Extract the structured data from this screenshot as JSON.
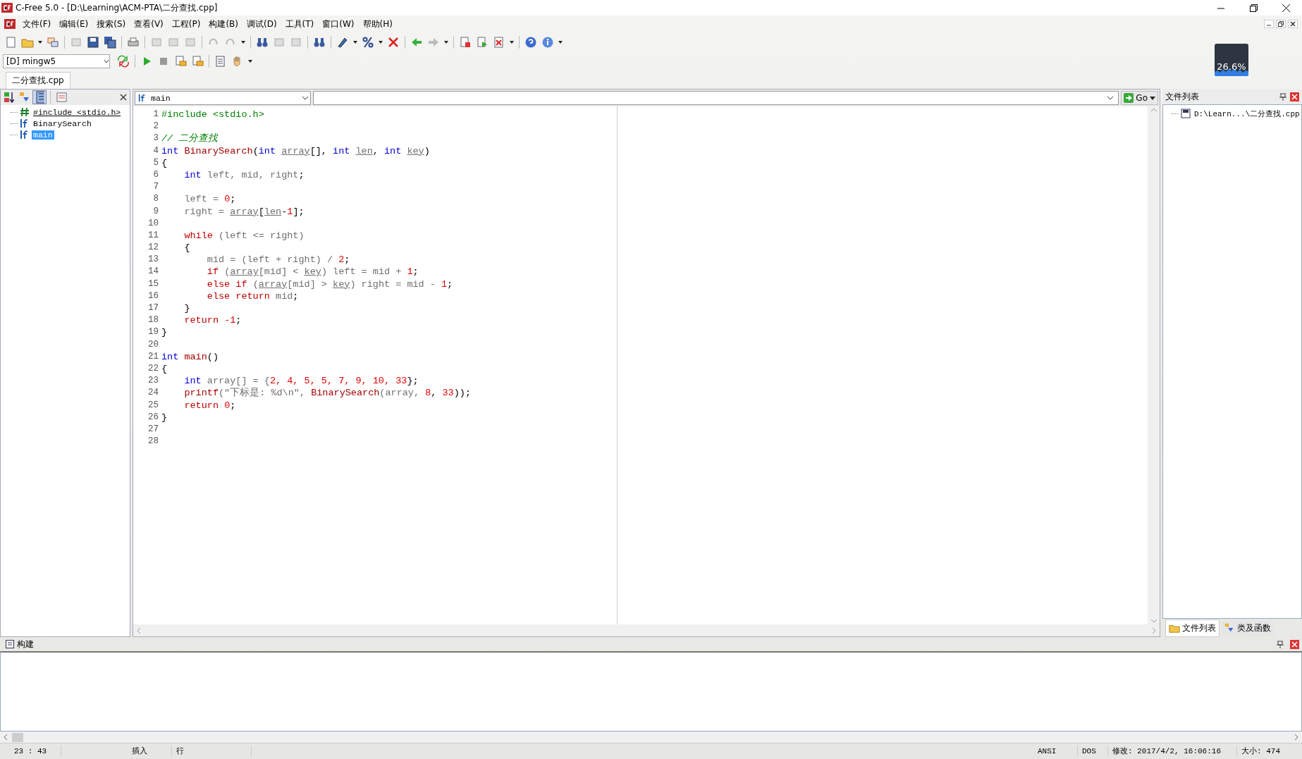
{
  "window": {
    "title": "C-Free 5.0 - [D:\\Learning\\ACM-PTA\\二分查找.cpp]"
  },
  "menu": [
    "文件(F)",
    "编辑(E)",
    "搜索(S)",
    "查看(V)",
    "工程(P)",
    "构建(B)",
    "调试(D)",
    "工具(T)",
    "窗口(W)",
    "帮助(H)"
  ],
  "compiler": {
    "value": "[D] mingw5"
  },
  "cpu_meter": {
    "reading": "26.6%"
  },
  "document_tabs": [
    {
      "label": "二分查找.cpp",
      "selected": true
    }
  ],
  "symbols": [
    {
      "text": "#include <stdio.h>",
      "kind": "include",
      "selected": false
    },
    {
      "text": "BinarySearch",
      "kind": "function",
      "selected": false
    },
    {
      "text": "main",
      "kind": "function",
      "selected": true
    }
  ],
  "editor": {
    "function_dropdown": "main",
    "go_button": "Go",
    "lines": [
      {
        "number": "1",
        "tokens": [
          {
            "text": "#include <stdio.h>",
            "kind": "pre"
          }
        ]
      },
      {
        "number": "2"
      },
      {
        "number": "3",
        "tokens": [
          {
            "text": "// 二分查找",
            "kind": "cm"
          }
        ]
      },
      {
        "number": "4",
        "tokens": [
          {
            "text": "int ",
            "kind": "type"
          },
          {
            "text": "BinarySearch",
            "kind": "fn"
          },
          {
            "text": "(",
            "kind": "p"
          },
          {
            "text": "int ",
            "kind": "type"
          },
          {
            "text": "array",
            "kind": "param"
          },
          {
            "text": "[], ",
            "kind": "p"
          },
          {
            "text": "int ",
            "kind": "type"
          },
          {
            "text": "len",
            "kind": "param"
          },
          {
            "text": ", ",
            "kind": "p"
          },
          {
            "text": "int ",
            "kind": "type"
          },
          {
            "text": "key",
            "kind": "param"
          },
          {
            "text": ")",
            "kind": "p"
          }
        ]
      },
      {
        "number": "5",
        "tokens": [
          {
            "text": "{",
            "kind": "p"
          }
        ]
      },
      {
        "number": "6",
        "tokens": [
          {
            "text": "    int ",
            "kind": "type"
          },
          {
            "text": "left, mid, right",
            "kind": "id"
          },
          {
            "text": ";",
            "kind": "p"
          }
        ]
      },
      {
        "number": "7"
      },
      {
        "number": "8",
        "tokens": [
          {
            "text": "    left = ",
            "kind": "id"
          },
          {
            "text": "0",
            "kind": "num"
          },
          {
            "text": ";",
            "kind": "p"
          }
        ]
      },
      {
        "number": "9",
        "tokens": [
          {
            "text": "    right = ",
            "kind": "id"
          },
          {
            "text": "array",
            "kind": "param"
          },
          {
            "text": "[",
            "kind": "p"
          },
          {
            "text": "len",
            "kind": "param"
          },
          {
            "text": "-",
            "kind": "p"
          },
          {
            "text": "1",
            "kind": "num"
          },
          {
            "text": "];",
            "kind": "p"
          }
        ]
      },
      {
        "number": "10"
      },
      {
        "number": "11",
        "tokens": [
          {
            "text": "    while",
            "kind": "kw"
          },
          {
            "text": " (left <= right)",
            "kind": "id"
          }
        ]
      },
      {
        "number": "12",
        "tokens": [
          {
            "text": "    {",
            "kind": "p"
          }
        ]
      },
      {
        "number": "13",
        "tokens": [
          {
            "text": "        mid = (left + right) / ",
            "kind": "id"
          },
          {
            "text": "2",
            "kind": "num"
          },
          {
            "text": ";",
            "kind": "p"
          }
        ]
      },
      {
        "number": "14",
        "tokens": [
          {
            "text": "        if ",
            "kind": "kw"
          },
          {
            "text": "(",
            "kind": "id"
          },
          {
            "text": "array",
            "kind": "param"
          },
          {
            "text": "[mid] < ",
            "kind": "id"
          },
          {
            "text": "key",
            "kind": "param"
          },
          {
            "text": ") left = mid + ",
            "kind": "id"
          },
          {
            "text": "1",
            "kind": "num"
          },
          {
            "text": ";",
            "kind": "p"
          }
        ]
      },
      {
        "number": "15",
        "tokens": [
          {
            "text": "        else if ",
            "kind": "kw"
          },
          {
            "text": "(",
            "kind": "id"
          },
          {
            "text": "array",
            "kind": "param"
          },
          {
            "text": "[mid] > ",
            "kind": "id"
          },
          {
            "text": "key",
            "kind": "param"
          },
          {
            "text": ") right = mid - ",
            "kind": "id"
          },
          {
            "text": "1",
            "kind": "num"
          },
          {
            "text": ";",
            "kind": "p"
          }
        ]
      },
      {
        "number": "16",
        "tokens": [
          {
            "text": "        else return ",
            "kind": "kw"
          },
          {
            "text": "mid",
            "kind": "id"
          },
          {
            "text": ";",
            "kind": "p"
          }
        ]
      },
      {
        "number": "17",
        "tokens": [
          {
            "text": "    }",
            "kind": "p"
          }
        ]
      },
      {
        "number": "18",
        "tokens": [
          {
            "text": "    return ",
            "kind": "kw"
          },
          {
            "text": "-1",
            "kind": "num"
          },
          {
            "text": ";",
            "kind": "p"
          }
        ]
      },
      {
        "number": "19",
        "tokens": [
          {
            "text": "}",
            "kind": "p"
          }
        ]
      },
      {
        "number": "20"
      },
      {
        "number": "21",
        "tokens": [
          {
            "text": "int ",
            "kind": "type"
          },
          {
            "text": "main",
            "kind": "fn"
          },
          {
            "text": "()",
            "kind": "p"
          }
        ]
      },
      {
        "number": "22",
        "tokens": [
          {
            "text": "{",
            "kind": "p"
          }
        ]
      },
      {
        "number": "23",
        "tokens": [
          {
            "text": "    int ",
            "kind": "type"
          },
          {
            "text": "array[] = {",
            "kind": "id"
          },
          {
            "text": "2, 4, 5, 5, 7, 9, 10, 33",
            "kind": "num"
          },
          {
            "text": "};",
            "kind": "p"
          }
        ]
      },
      {
        "number": "24",
        "tokens": [
          {
            "text": "    printf",
            "kind": "fn"
          },
          {
            "text": "(\"下标是: %d\\n\", ",
            "kind": "id"
          },
          {
            "text": "BinarySearch",
            "kind": "fn"
          },
          {
            "text": "(array, ",
            "kind": "id"
          },
          {
            "text": "8",
            "kind": "num"
          },
          {
            "text": ", ",
            "kind": "p"
          },
          {
            "text": "33",
            "kind": "num"
          },
          {
            "text": "));",
            "kind": "p"
          }
        ]
      },
      {
        "number": "25",
        "tokens": [
          {
            "text": "    return ",
            "kind": "kw"
          },
          {
            "text": "0",
            "kind": "num"
          },
          {
            "text": ";",
            "kind": "p"
          }
        ]
      },
      {
        "number": "26",
        "tokens": [
          {
            "text": "}",
            "kind": "p"
          }
        ]
      },
      {
        "number": "27"
      },
      {
        "number": "28"
      }
    ]
  },
  "file_list": {
    "title": "文件列表",
    "items": [
      {
        "text": "D:\\Learn...\\二分查找.cpp"
      }
    ],
    "tabs": [
      {
        "label": "文件列表",
        "kind": "files",
        "selected": true
      },
      {
        "label": "类及函数",
        "kind": "classes",
        "selected": false
      }
    ]
  },
  "build_panel": {
    "title": "构建"
  },
  "status_bar": {
    "position": "23 : 43",
    "mode": "插入",
    "unit": "行",
    "encoding": "ANSI",
    "line_ending": "DOS",
    "modified": "修改: 2017/4/2, 16:06:16",
    "size": "大小: 474"
  }
}
